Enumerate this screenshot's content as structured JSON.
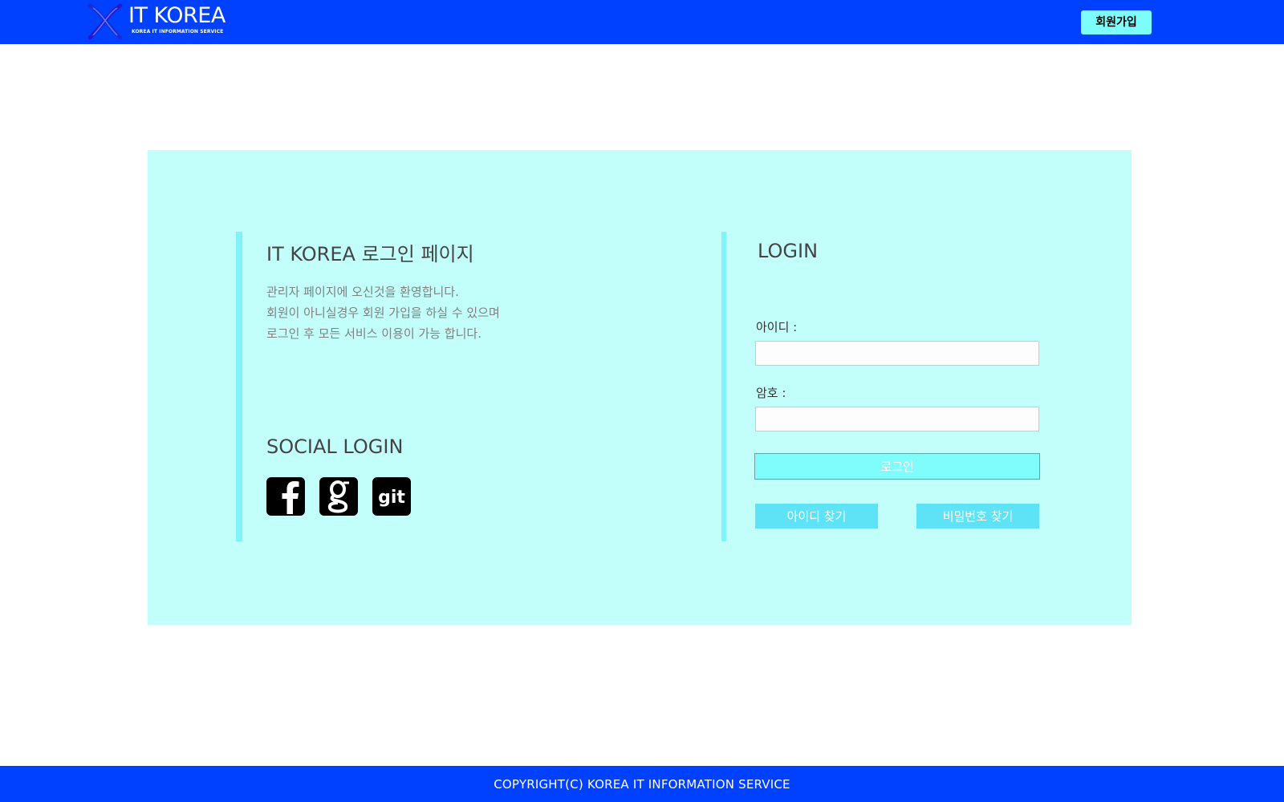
{
  "header": {
    "logo_title": "IT KOREA",
    "logo_subtitle": "KOREA IT INFORMATION SERVICE",
    "signup_label": "회원가입"
  },
  "intro": {
    "title": "IT KOREA 로그인 페이지",
    "lines": [
      "관리자 페이지에 오신것을 환영합니다.",
      "회원이 아니실경우 회원 가입을 하실 수 있으며",
      "로그인 후 모든 서비스 이용이 가능 합니다."
    ]
  },
  "social": {
    "title": "SOCIAL LOGIN",
    "icons": [
      "facebook-icon",
      "google-icon",
      "git-icon"
    ]
  },
  "login": {
    "title": "LOGIN",
    "id_label": "아이디 :",
    "id_value": "",
    "pw_label": "암호 :",
    "pw_value": "",
    "submit_label": "로그인",
    "find_id_label": "아이디 찾기",
    "find_pw_label": "비밀번호 찾기"
  },
  "footer": {
    "copyright": "COPYRIGHT(C) KOREA IT INFORMATION SERVICE"
  },
  "colors": {
    "header_bg": "#0041ff",
    "panel_bg": "#c2fffb",
    "accent": "#7dfcfc",
    "find_button": "#5ee3f6"
  }
}
